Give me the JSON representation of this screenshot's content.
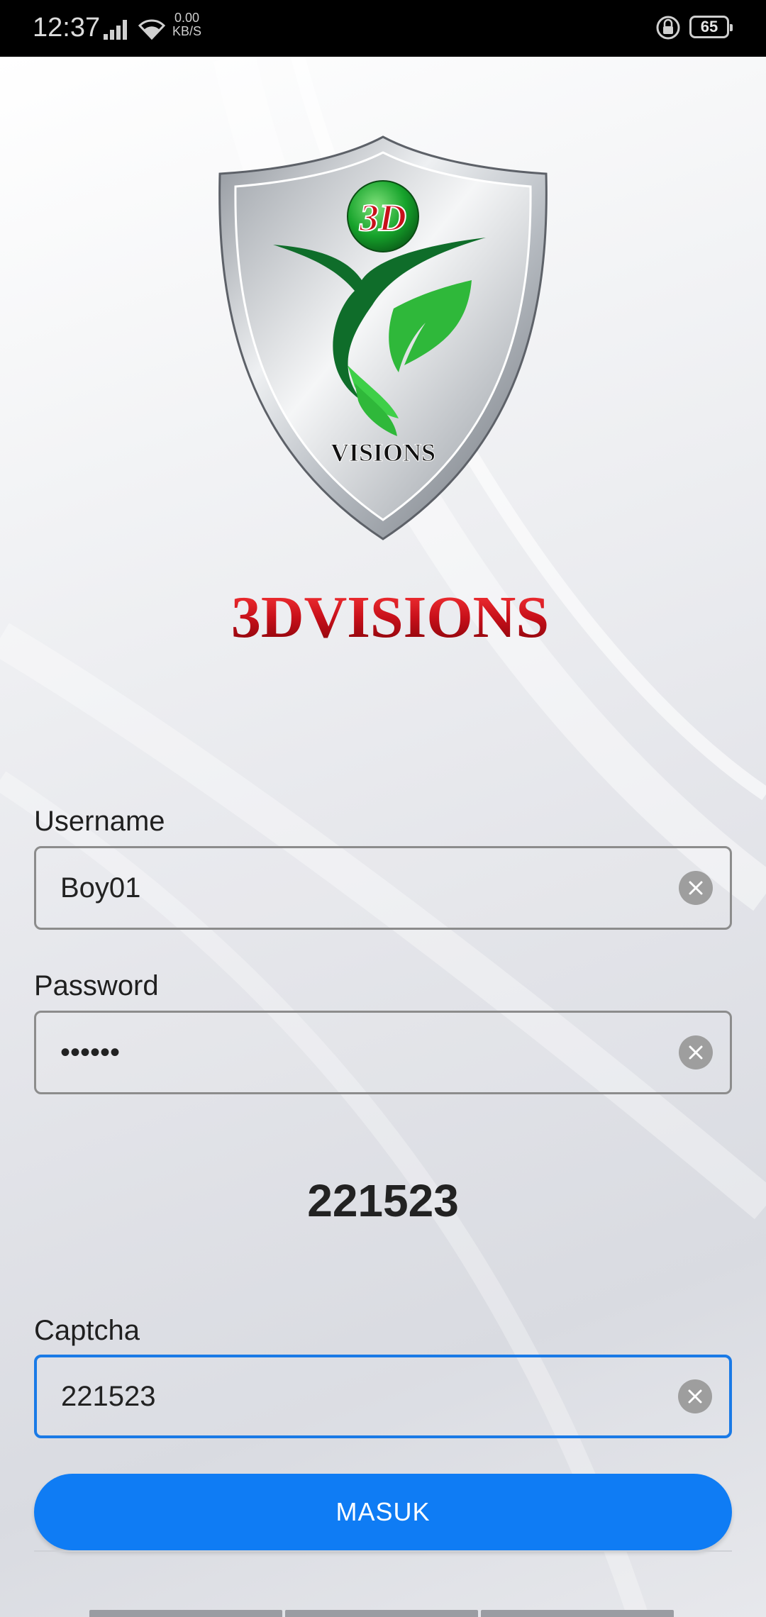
{
  "status_bar": {
    "time": "12:37",
    "net_speed_value": "0.00",
    "net_speed_unit": "KB/S",
    "battery": "65"
  },
  "brand": {
    "logo_badge_text": "3D",
    "logo_shield_text": "VISIONS",
    "wordmark": "3DVISIONS"
  },
  "form": {
    "username_label": "Username",
    "username_value": "Boy01",
    "password_label": "Password",
    "password_value": "••••••",
    "captcha_code": "221523",
    "captcha_label": "Captcha",
    "captcha_value": "221523",
    "submit_label": "MASUK"
  },
  "colors": {
    "accent": "#0f7cf4",
    "focus_border": "#1a7ae6",
    "brand_red": "#c8101a",
    "leaf_green": "#2fb83a"
  }
}
